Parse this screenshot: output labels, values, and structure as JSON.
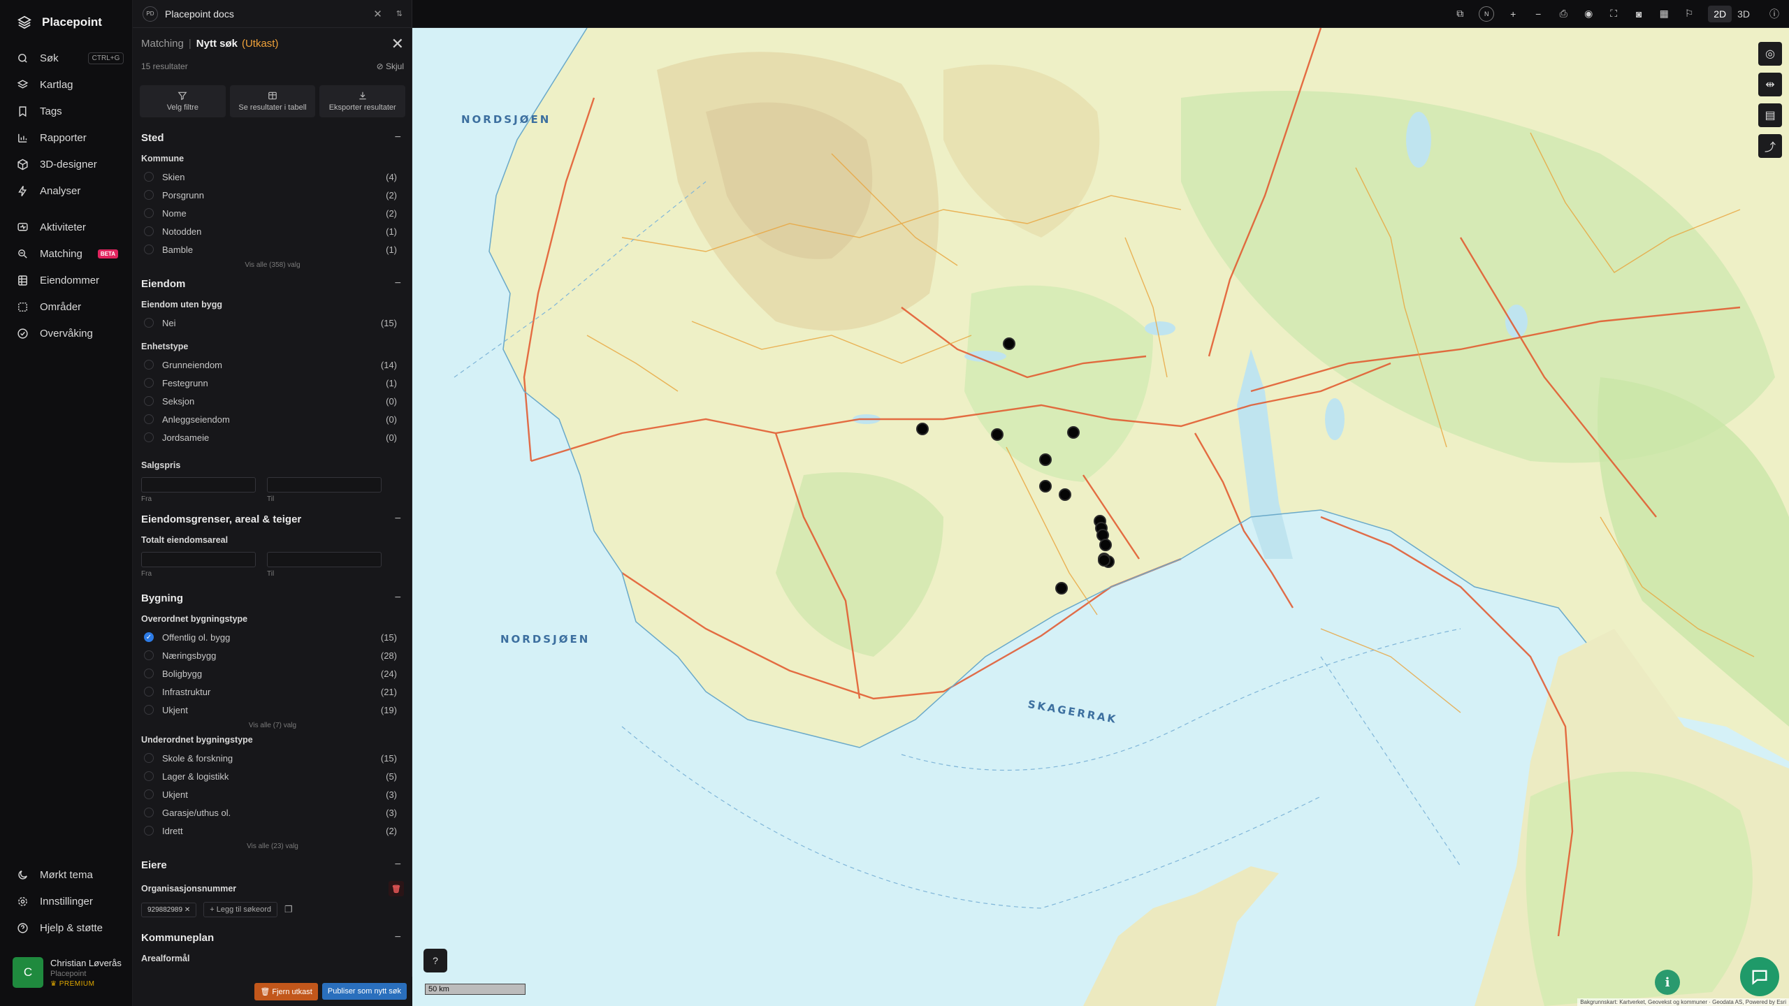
{
  "app": {
    "name": "Placepoint"
  },
  "nav": {
    "items": [
      {
        "label": "Søk",
        "shortcut": "CTRL+G"
      },
      {
        "label": "Kartlag"
      },
      {
        "label": "Tags"
      },
      {
        "label": "Rapporter"
      },
      {
        "label": "3D-designer"
      },
      {
        "label": "Analyser"
      }
    ],
    "items2": [
      {
        "label": "Aktiviteter"
      },
      {
        "label": "Matching",
        "badge": "BETA"
      },
      {
        "label": "Eiendommer"
      },
      {
        "label": "Områder"
      },
      {
        "label": "Overvåking"
      }
    ],
    "bottom": [
      {
        "label": "Mørkt tema"
      },
      {
        "label": "Innstillinger"
      },
      {
        "label": "Hjelp & støtte"
      }
    ],
    "user": {
      "initial": "C",
      "name": "Christian Løverås",
      "org": "Placepoint",
      "plan": "PREMIUM"
    }
  },
  "doc": {
    "badge": "PD",
    "title": "Placepoint docs"
  },
  "panel": {
    "crumb_parent": "Matching",
    "crumb_current": "Nytt søk",
    "crumb_status": "(Utkast)",
    "result_count": "15 resultater",
    "hide_label": "Skjul",
    "actions": [
      "Velg filtre",
      "Se resultater i tabell",
      "Eksporter resultater"
    ],
    "sections": {
      "sted": {
        "title": "Sted",
        "kommune_label": "Kommune",
        "kommune": [
          {
            "label": "Skien",
            "count": "(4)"
          },
          {
            "label": "Porsgrunn",
            "count": "(2)"
          },
          {
            "label": "Nome",
            "count": "(2)"
          },
          {
            "label": "Notodden",
            "count": "(1)"
          },
          {
            "label": "Bamble",
            "count": "(1)"
          }
        ],
        "show_all": "Vis alle (358) valg"
      },
      "eiendom": {
        "title": "Eiendom",
        "uten_bygg_label": "Eiendom uten bygg",
        "uten_bygg": [
          {
            "label": "Nei",
            "count": "(15)"
          }
        ],
        "enhetstype_label": "Enhetstype",
        "enhetstype": [
          {
            "label": "Grunneiendom",
            "count": "(14)"
          },
          {
            "label": "Festegrunn",
            "count": "(1)"
          },
          {
            "label": "Seksjon",
            "count": "(0)"
          },
          {
            "label": "Anleggseiendom",
            "count": "(0)"
          },
          {
            "label": "Jordsameie",
            "count": "(0)"
          }
        ],
        "salgspris_label": "Salgspris",
        "from": "Fra",
        "to": "Til"
      },
      "grenser": {
        "title": "Eiendomsgrenser, areal & teiger",
        "areal_label": "Totalt eiendomsareal",
        "from": "Fra",
        "to": "Til"
      },
      "bygning": {
        "title": "Bygning",
        "overordnet_label": "Overordnet bygningstype",
        "overordnet": [
          {
            "label": "Offentlig ol. bygg",
            "count": "(15)",
            "checked": true
          },
          {
            "label": "Næringsbygg",
            "count": "(28)"
          },
          {
            "label": "Boligbygg",
            "count": "(24)"
          },
          {
            "label": "Infrastruktur",
            "count": "(21)"
          },
          {
            "label": "Ukjent",
            "count": "(19)"
          }
        ],
        "overordnet_show_all": "Vis alle (7) valg",
        "underordnet_label": "Underordnet bygningstype",
        "underordnet": [
          {
            "label": "Skole & forskning",
            "count": "(15)"
          },
          {
            "label": "Lager & logistikk",
            "count": "(5)"
          },
          {
            "label": "Ukjent",
            "count": "(3)"
          },
          {
            "label": "Garasje/uthus ol.",
            "count": "(3)"
          },
          {
            "label": "Idrett",
            "count": "(2)"
          }
        ],
        "underordnet_show_all": "Vis alle (23) valg"
      },
      "eiere": {
        "title": "Eiere",
        "org_label": "Organisasjonsnummer",
        "org_chip": "929882989",
        "add_label": "+ Legg til søkeord"
      },
      "kommuneplan": {
        "title": "Kommuneplan",
        "arealformal_label": "Arealformål"
      }
    },
    "footer": {
      "remove": "Fjern utkast",
      "publish": "Publiser som nytt søk"
    }
  },
  "toolbar": {
    "compass": "N",
    "mode_2d": "2D",
    "mode_3d": "3D",
    "active_mode": "2D"
  },
  "map": {
    "labels": {
      "north_sea_1": "NORDSJØEN",
      "north_sea_2": "NORDSJØEN",
      "skagerrak": "SKAGERRAK"
    },
    "scale": "50 km",
    "attribution": "Bakgrunnskart: Kartverket, Geovekst og kommuner · Geodata AS, Powered by Esri"
  }
}
